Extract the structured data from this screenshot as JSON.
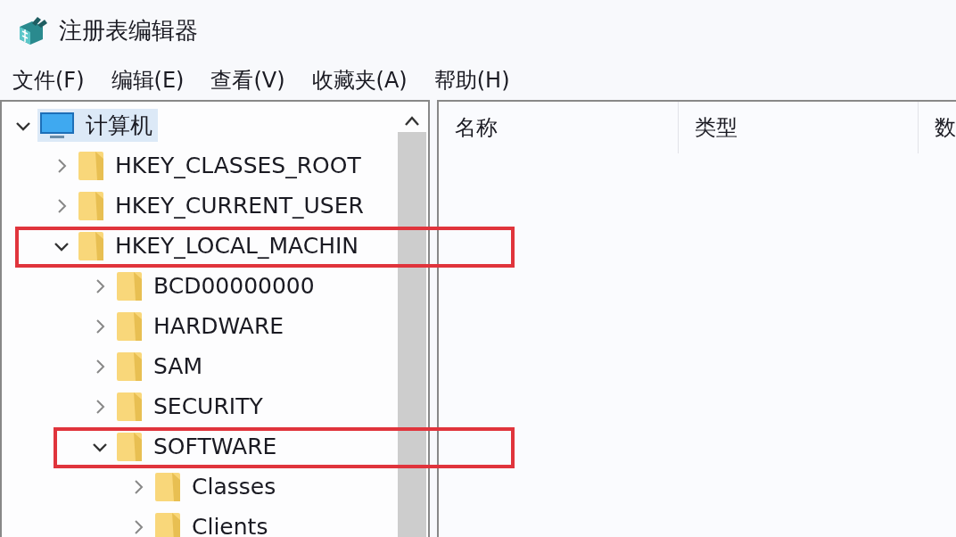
{
  "window": {
    "title": "注册表编辑器"
  },
  "menu": [
    {
      "label": "文件(F)"
    },
    {
      "label": "编辑(E)"
    },
    {
      "label": "查看(V)"
    },
    {
      "label": "收藏夹(A)"
    },
    {
      "label": "帮助(H)"
    }
  ],
  "tree": [
    {
      "label": "计算机",
      "kind": "computer",
      "expanded": true,
      "selected": true,
      "highlighted": false,
      "children": [
        {
          "label": "HKEY_CLASSES_ROOT",
          "kind": "folder",
          "expanded": false,
          "selected": false,
          "highlighted": false
        },
        {
          "label": "HKEY_CURRENT_USER",
          "kind": "folder",
          "expanded": false,
          "selected": false,
          "highlighted": false
        },
        {
          "label": "HKEY_LOCAL_MACHIN",
          "kind": "folder",
          "expanded": true,
          "selected": false,
          "highlighted": true,
          "children": [
            {
              "label": "BCD00000000",
              "kind": "folder",
              "expanded": false,
              "selected": false,
              "highlighted": false
            },
            {
              "label": "HARDWARE",
              "kind": "folder",
              "expanded": false,
              "selected": false,
              "highlighted": false
            },
            {
              "label": "SAM",
              "kind": "folder",
              "expanded": false,
              "selected": false,
              "highlighted": false
            },
            {
              "label": "SECURITY",
              "kind": "folder",
              "expanded": false,
              "selected": false,
              "highlighted": false
            },
            {
              "label": "SOFTWARE",
              "kind": "folder",
              "expanded": true,
              "selected": false,
              "highlighted": true,
              "children": [
                {
                  "label": "Classes",
                  "kind": "folder",
                  "expanded": false,
                  "selected": false,
                  "highlighted": false
                },
                {
                  "label": "Clients",
                  "kind": "folder",
                  "expanded": false,
                  "selected": false,
                  "highlighted": false
                }
              ]
            }
          ]
        }
      ]
    }
  ],
  "table": {
    "columns": [
      "名称",
      "类型",
      "数"
    ]
  }
}
